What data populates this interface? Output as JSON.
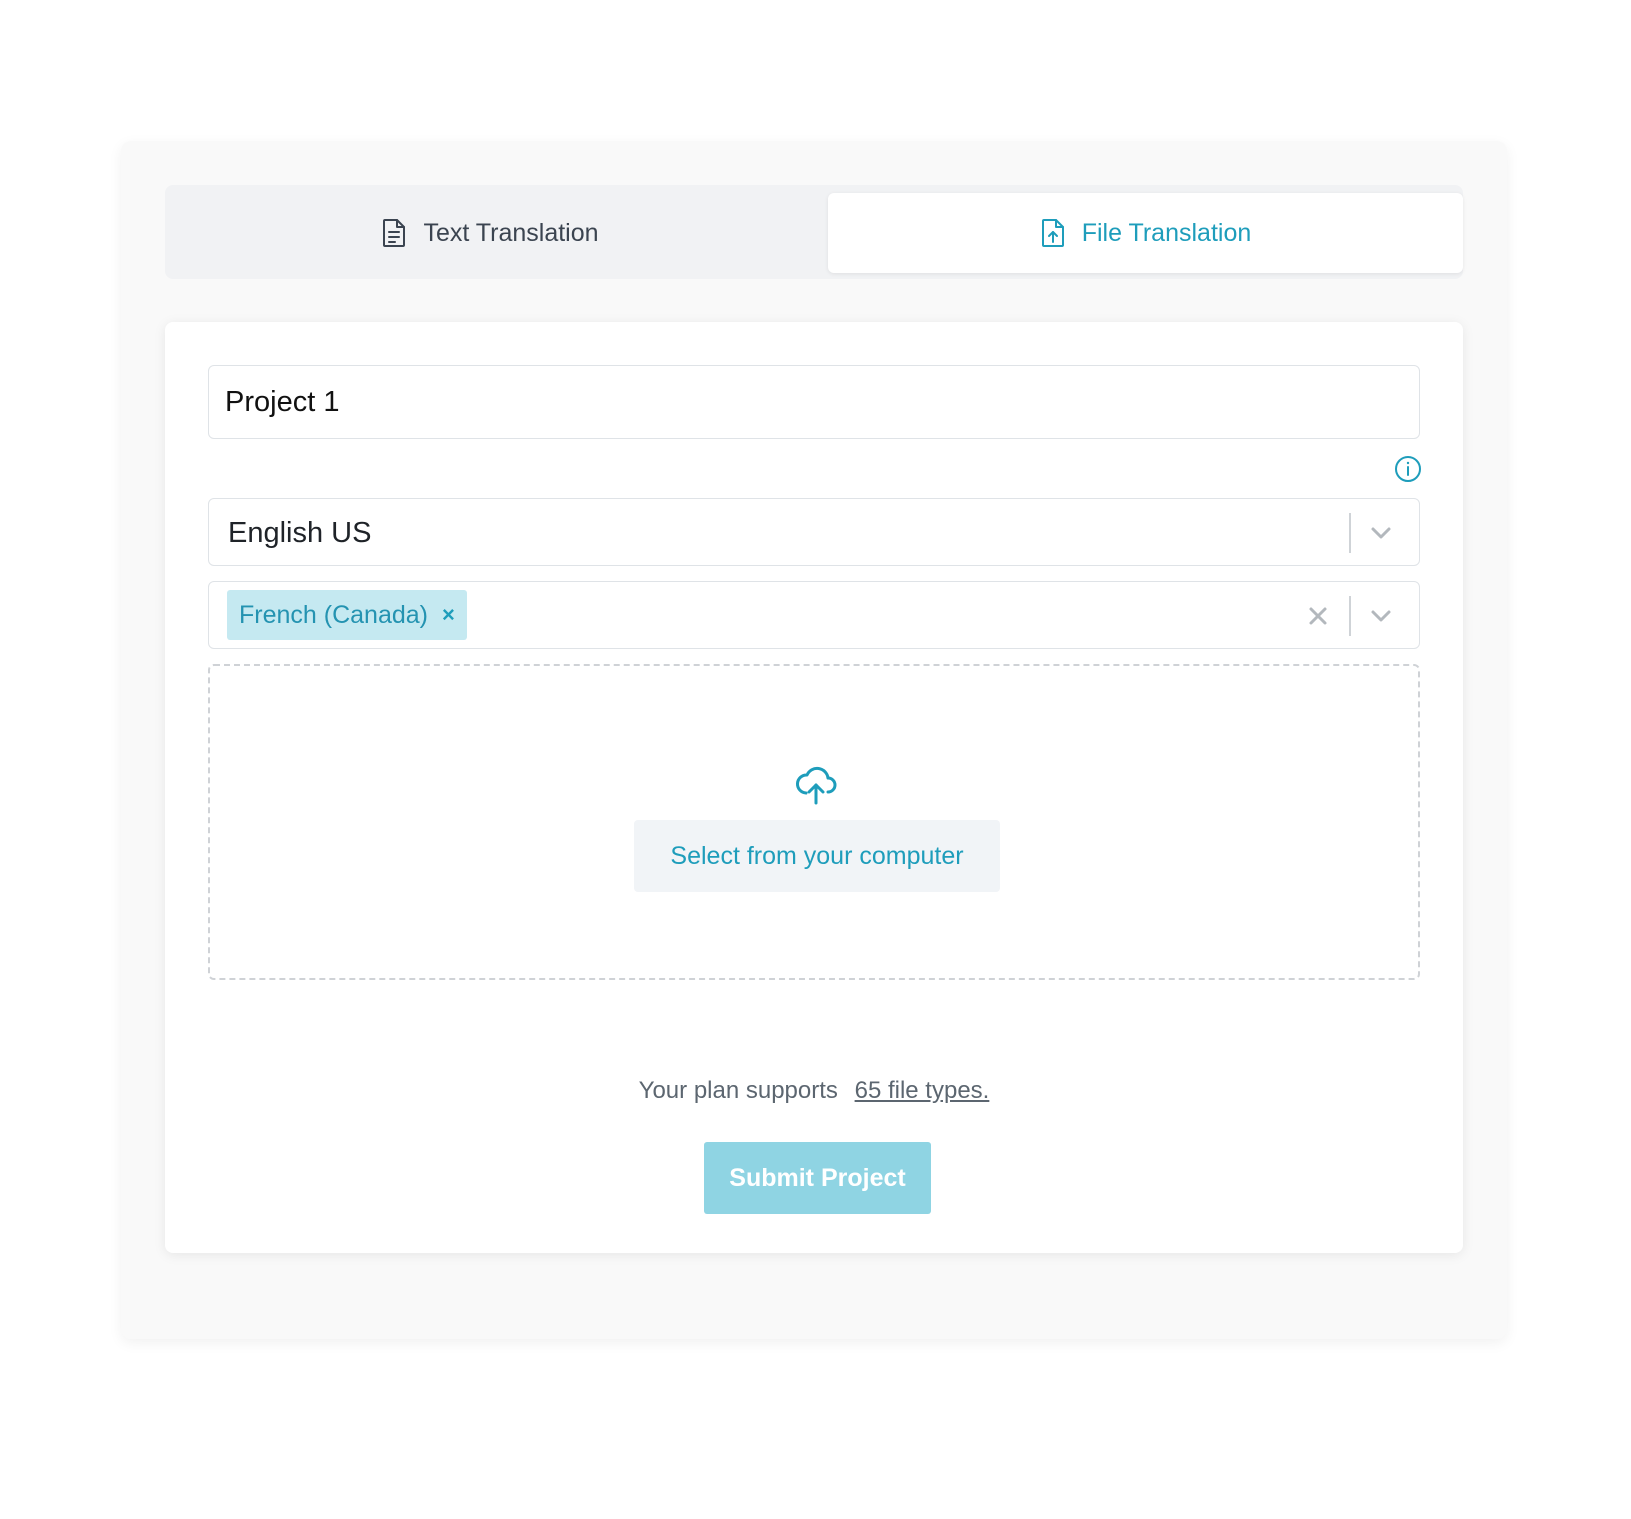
{
  "tabs": {
    "text_translation": {
      "label": "Text Translation",
      "icon": "document-icon"
    },
    "file_translation": {
      "label": "File Translation",
      "icon": "file-upload-icon",
      "active": true
    }
  },
  "form": {
    "project_name": "Project 1",
    "source_language": "English US",
    "target_languages": [
      "French (Canada)"
    ],
    "chip_remove": "×",
    "upload_button": "Select from your computer",
    "plan_text": "Your plan supports",
    "plan_link": "65 file types.",
    "submit_label": "Submit Project"
  },
  "colors": {
    "accent": "#1e9dbb",
    "chip_bg": "#c5e9f1",
    "submit_disabled": "#8fd4e3"
  }
}
